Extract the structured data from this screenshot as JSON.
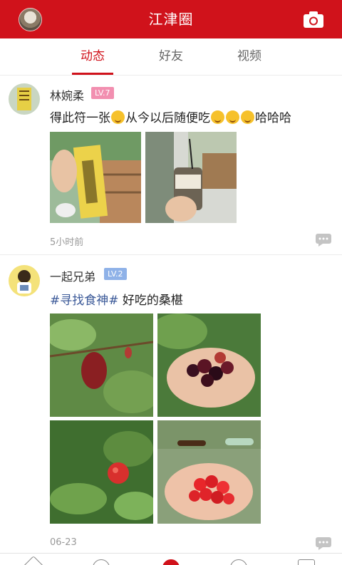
{
  "header": {
    "title": "江津圈",
    "brand_color": "#d0121b"
  },
  "tabs": [
    {
      "label": "动态",
      "active": true
    },
    {
      "label": "好友",
      "active": false
    },
    {
      "label": "视频",
      "active": false
    }
  ],
  "posts": [
    {
      "author": "林婉柔",
      "level": "LV.7",
      "level_color": "#f28fb0",
      "text_before": "得此符一张",
      "text_middle": "从今以后随便吃",
      "text_after": "哈哈哈",
      "photo_count": 2,
      "time": "5小时前",
      "icons": [
        "comment-icon"
      ]
    },
    {
      "author": "一起兄弟",
      "level": "LV.2",
      "level_color": "#8fb2e8",
      "hashtag": "#寻找食神#",
      "text": "好吃的桑椹",
      "photo_count": 4,
      "time": "06-23",
      "icons": [
        "comment-icon"
      ]
    }
  ],
  "bottom_nav": {
    "icons": [
      "home-icon",
      "discover-icon",
      "center-icon",
      "message-icon",
      "profile-icon"
    ]
  }
}
